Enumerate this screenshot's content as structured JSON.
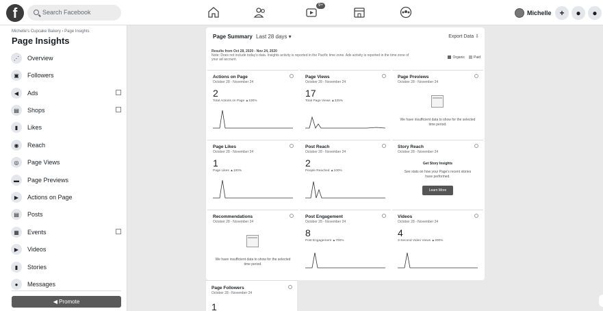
{
  "topbar": {
    "logo": "f",
    "search_placeholder": "Search Facebook",
    "watch_badge": "9+",
    "user_name": "Michelle",
    "plus": "+",
    "messenger": "●",
    "notifications": "●"
  },
  "sidebar": {
    "breadcrumb": "Michelle's Cupcake Bakery › Page Insights",
    "title": "Page Insights",
    "items": [
      {
        "label": "Overview",
        "icon": "chart-icon"
      },
      {
        "label": "Followers",
        "icon": "followers-icon"
      },
      {
        "label": "Ads",
        "icon": "megaphone-icon"
      },
      {
        "label": "Shops",
        "icon": "shop-icon"
      },
      {
        "label": "Likes",
        "icon": "thumbs-up-icon"
      },
      {
        "label": "Reach",
        "icon": "reach-icon"
      },
      {
        "label": "Page Views",
        "icon": "eye-icon"
      },
      {
        "label": "Page Previews",
        "icon": "preview-icon"
      },
      {
        "label": "Actions on Page",
        "icon": "cursor-icon"
      },
      {
        "label": "Posts",
        "icon": "posts-icon"
      },
      {
        "label": "Events",
        "icon": "calendar-icon"
      },
      {
        "label": "Videos",
        "icon": "video-icon"
      },
      {
        "label": "Stories",
        "icon": "stories-icon"
      },
      {
        "label": "Messages",
        "icon": "messages-icon"
      }
    ],
    "promote_label": "Promote"
  },
  "summary": {
    "title": "Page Summary",
    "range": "Last 28 days",
    "export": "Export Data",
    "note_results": "Results from Oct 28, 2020 - Nov 24, 2020",
    "note_text": "Note: Does not include today's data. Insights activity is reported in the Pacific time zone. Ads activity is reported in the time zone of your ad account.",
    "legend_organic": "Organic",
    "legend_paid": "Paid",
    "colors": {
      "organic": "#666666",
      "paid": "#b0b0b0"
    }
  },
  "tiles": [
    {
      "title": "Actions on Page",
      "sub": "October 28 - November 24",
      "value": "2",
      "caption": "Total Actions on Page ▲100%"
    },
    {
      "title": "Page Views",
      "sub": "October 28 - November 24",
      "value": "17",
      "caption": "Total Page Views ▲325%"
    },
    {
      "title": "Page Previews",
      "sub": "October 28 - November 24",
      "msg": "We have insufficient data to show for the selected time period."
    },
    {
      "title": "Page Likes",
      "sub": "October 28 - November 24",
      "value": "1",
      "caption": "Page Likes ▲100%"
    },
    {
      "title": "Post Reach",
      "sub": "October 28 - November 24",
      "value": "2",
      "caption": "People Reached ▲100%"
    },
    {
      "title": "Story Reach",
      "sub": "October 28 - November 24",
      "heading": "Get Story Insights",
      "body": "See stats on how your Page's recent stories have performed.",
      "button": "Learn More"
    },
    {
      "title": "Recommendations",
      "sub": "October 28 - November 24",
      "msg": "We have insufficient data to show for the selected time period."
    },
    {
      "title": "Post Engagement",
      "sub": "October 28 - November 24",
      "value": "8",
      "caption": "Post Engagement ▲700%"
    },
    {
      "title": "Videos",
      "sub": "October 28 - November 24",
      "value": "4",
      "caption": "3-Second Video Views ▲300%"
    },
    {
      "title": "Page Followers",
      "sub": "October 28 - November 24",
      "value": "1"
    }
  ]
}
